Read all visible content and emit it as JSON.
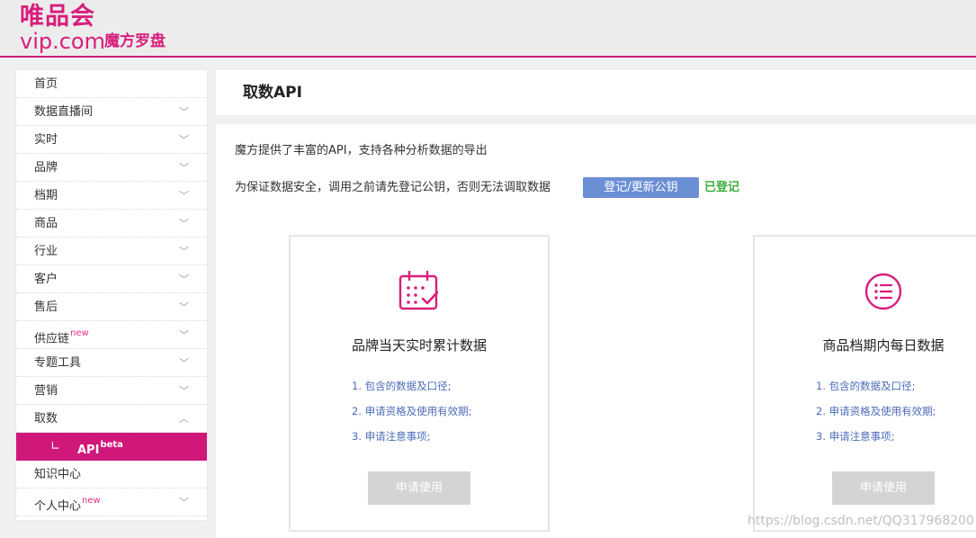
{
  "header": {
    "logo_cn": "唯品会",
    "logo_en": "vip.com",
    "logo_sub": "魔方罗盘"
  },
  "sidebar": {
    "items": [
      {
        "label": "首页",
        "chevron": ""
      },
      {
        "label": "数据直播间",
        "chevron": "﹀"
      },
      {
        "label": "实时",
        "chevron": "﹀"
      },
      {
        "label": "品牌",
        "chevron": "﹀"
      },
      {
        "label": "档期",
        "chevron": "﹀"
      },
      {
        "label": "商品",
        "chevron": "﹀"
      },
      {
        "label": "行业",
        "chevron": "﹀"
      },
      {
        "label": "客户",
        "chevron": "﹀"
      },
      {
        "label": "售后",
        "chevron": "﹀"
      },
      {
        "label": "供应链",
        "badge": "new",
        "chevron": "﹀"
      },
      {
        "label": "专题工具",
        "chevron": "﹀"
      },
      {
        "label": "营销",
        "chevron": "﹀"
      },
      {
        "label": "取数",
        "chevron": "︿"
      }
    ],
    "sub_item": {
      "elbow": "∟",
      "label": "API",
      "badge": "beta"
    },
    "tail_items": [
      {
        "label": "知识中心",
        "chevron": ""
      },
      {
        "label": "个人中心",
        "badge": "new",
        "chevron": "﹀"
      }
    ]
  },
  "main": {
    "title": "取数API",
    "intro": "魔方提供了丰富的API，支持各种分析数据的导出",
    "notice": "为保证数据安全，调用之前请先登记公钥，否则无法调取数据",
    "register_button": "登记/更新公钥",
    "register_status": "已登记",
    "cards": [
      {
        "icon": "calendar-check-icon",
        "title": "品牌当天实时累计数据",
        "items": [
          "1. 包含的数据及口径;",
          "2. 申请资格及使用有效期;",
          "3. 申请注意事项;"
        ],
        "button": "申请使用"
      },
      {
        "icon": "list-circle-icon",
        "title": "商品档期内每日数据",
        "items": [
          "1. 包含的数据及口径;",
          "2. 申请资格及使用有效期;",
          "3. 申请注意事项;"
        ],
        "button": "申请使用"
      }
    ]
  },
  "watermark": "https://blog.csdn.net/QQ317968200",
  "colors": {
    "brand": "#d81e7c",
    "active": "#d0177a",
    "button_blue": "#6b8fd4",
    "status_green": "#3aae3a",
    "link_blue": "#4b6cb7"
  }
}
